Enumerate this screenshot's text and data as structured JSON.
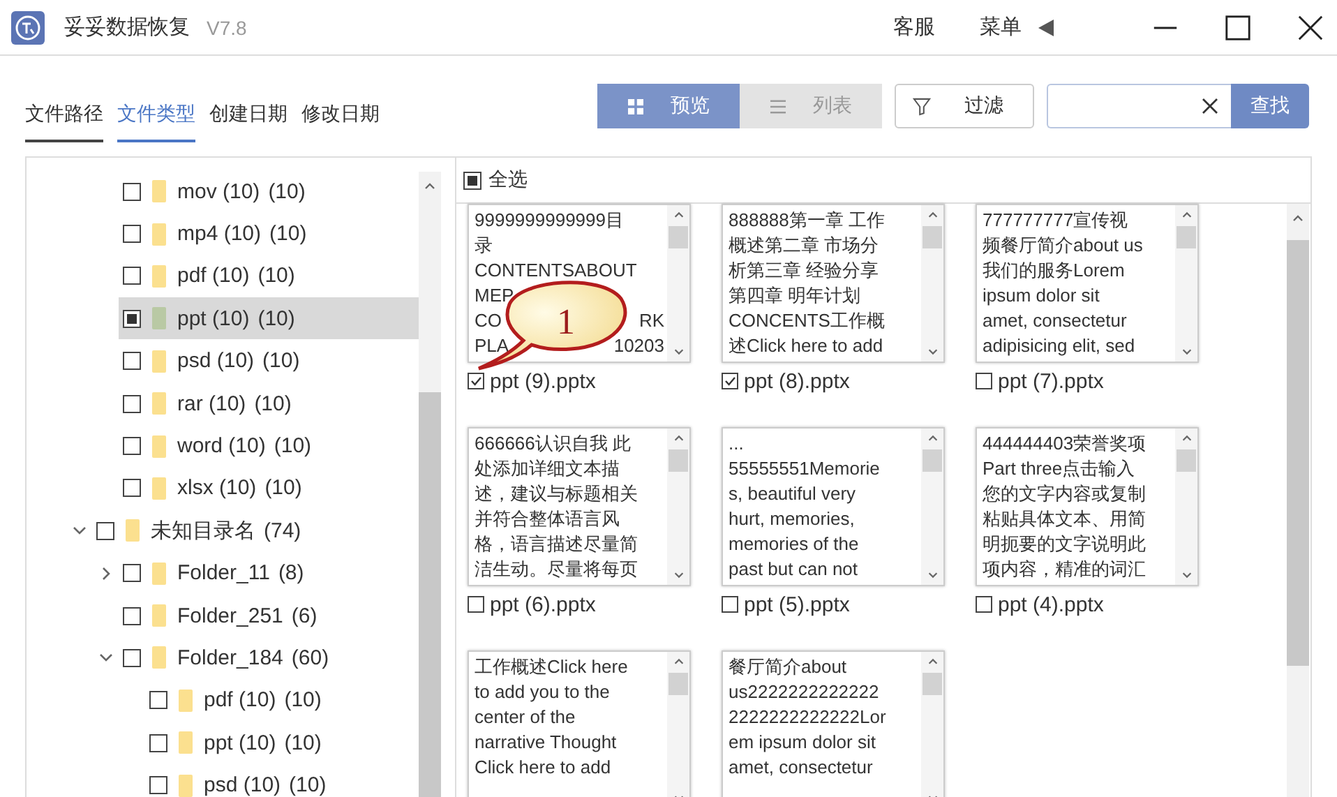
{
  "window": {
    "title": "妥妥数据恢复",
    "version": "V7.8",
    "links": [
      "客服",
      "菜单"
    ]
  },
  "tabs": [
    {
      "label": "文件路径",
      "selected": false,
      "underlined": true
    },
    {
      "label": "文件类型",
      "selected": true,
      "underlined": true
    },
    {
      "label": "创建日期",
      "selected": false,
      "underlined": false
    },
    {
      "label": "修改日期",
      "selected": false,
      "underlined": false
    }
  ],
  "view_toggle": [
    {
      "label": "预览",
      "kind": "grid",
      "selected": true
    },
    {
      "label": "列表",
      "kind": "list",
      "selected": false
    }
  ],
  "filter_button": "过滤",
  "search": {
    "button": "查找"
  },
  "tree": [
    {
      "children": [
        {
          "name": "mov (10)",
          "count": "(10)",
          "partial": false,
          "selected": false
        },
        {
          "name": "mp4 (10)",
          "count": "(10)",
          "partial": false,
          "selected": false
        },
        {
          "name": "pdf (10)",
          "count": "(10)",
          "partial": false,
          "selected": false
        },
        {
          "name": "ppt (10)",
          "count": "(10)",
          "partial": true,
          "selected": true
        },
        {
          "name": "psd (10)",
          "count": "(10)",
          "partial": false,
          "selected": false
        },
        {
          "name": "rar (10)",
          "count": "(10)",
          "partial": false,
          "selected": false
        },
        {
          "name": "word (10)",
          "count": "(10)",
          "partial": false,
          "selected": false
        },
        {
          "name": "xlsx (10)",
          "count": "(10)",
          "partial": false,
          "selected": false
        }
      ]
    },
    {
      "name": "未知目录名",
      "count": "(74)",
      "partial": false,
      "selected": false,
      "expanded": true,
      "children": [
        {
          "name": "Folder_11",
          "count": "(8)",
          "partial": false,
          "selected": false,
          "expanded": false
        },
        {
          "name": "Folder_251",
          "count": "(6)",
          "partial": false,
          "selected": false
        },
        {
          "name": "Folder_184",
          "count": "(60)",
          "partial": false,
          "selected": false,
          "expanded": true,
          "children": [
            {
              "name": "pdf (10)",
              "count": "(10)",
              "partial": false,
              "selected": false
            },
            {
              "name": "ppt (10)",
              "count": "(10)",
              "partial": false,
              "selected": false
            },
            {
              "name": "psd (10)",
              "count": "(10)",
              "partial": false,
              "selected": false
            }
          ]
        }
      ]
    }
  ],
  "select_all": {
    "label": "全选",
    "partial": true
  },
  "files": [
    {
      "name": "ppt (9).pptx",
      "checked": true,
      "lines": [
        "9999999999999目",
        "录",
        "CONTENTSABOUT",
        [
          "MEP"
        ],
        [
          "CO",
          "RK"
        ],
        [
          "PLA",
          "10203"
        ]
      ]
    },
    {
      "name": "ppt (8).pptx",
      "checked": true,
      "lines": [
        "888888第一章 工作",
        "概述第二章  市场分",
        "析第三章  经验分享",
        "第四章  明年计划",
        "CONCENTS工作概",
        "述Click here to add"
      ]
    },
    {
      "name": "ppt (7).pptx",
      "checked": false,
      "lines": [
        "777777777宣传视",
        "频餐厅简介about us",
        "我们的服务Lorem",
        "ipsum dolor sit",
        "amet, consectetur",
        "adipisicing elit, sed"
      ]
    },
    {
      "name": "ppt (6).pptx",
      "checked": false,
      "lines": [
        "666666认识自我  此",
        "处添加详细文本描",
        "述，建议与标题相关",
        "并符合整体语言风",
        "格，语言描述尽量简",
        "洁生动。尽量将每页"
      ]
    },
    {
      "name": "ppt (5).pptx",
      "checked": false,
      "lines": [
        "...",
        "55555551Memorie",
        "s, beautiful very",
        "hurt, memories,",
        "memories of the",
        "past but can not"
      ]
    },
    {
      "name": "ppt (4).pptx",
      "checked": false,
      "lines": [
        "444444403荣誉奖项",
        "Part three点击输入",
        "您的文字内容或复制",
        "粘贴具体文本、用简",
        "明扼要的文字说明此",
        "项内容，精准的词汇"
      ]
    },
    {
      "lines": [
        "工作概述Click here",
        "to add  you to the",
        "center of the",
        "narrative Thought",
        "Click here to add"
      ]
    },
    {
      "lines": [
        "餐厅简介about",
        "us2222222222222",
        "2222222222222Lor",
        "em ipsum dolor sit",
        "amet, consectetur"
      ]
    }
  ],
  "callout": {
    "label": "1"
  }
}
